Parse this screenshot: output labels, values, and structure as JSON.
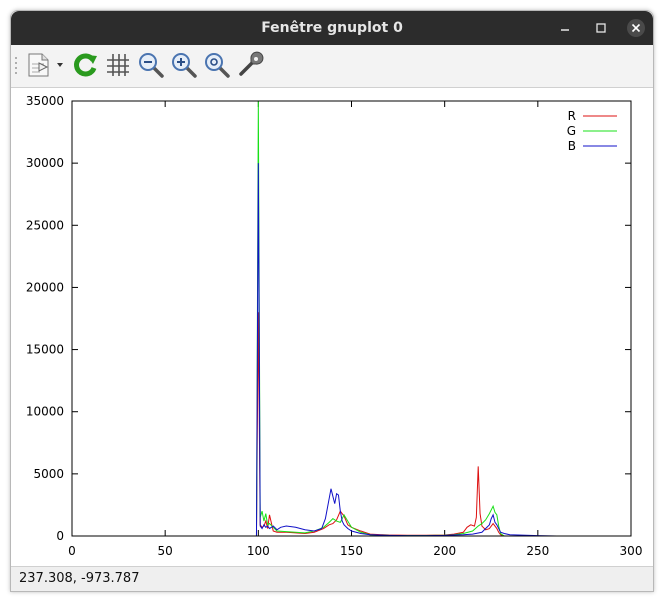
{
  "window": {
    "title": "Fenêtre gnuplot 0"
  },
  "toolbar": {
    "icons": [
      "export-icon",
      "replot-icon",
      "grid-icon",
      "zoom-out-icon",
      "zoom-in-icon",
      "zoom-reset-icon",
      "settings-icon"
    ]
  },
  "statusbar": {
    "coords": "237.308, -973.787"
  },
  "colors": {
    "R": "#dd1010",
    "G": "#18e018",
    "B": "#1010c8"
  },
  "chart_data": {
    "type": "line",
    "title": "",
    "xlabel": "",
    "ylabel": "",
    "xlim": [
      0,
      300
    ],
    "ylim": [
      0,
      35000
    ],
    "xticks": [
      0,
      50,
      100,
      150,
      200,
      250,
      300
    ],
    "yticks": [
      0,
      5000,
      10000,
      15000,
      20000,
      25000,
      30000,
      35000
    ],
    "grid": false,
    "legend_position": "top-right",
    "series": [
      {
        "name": "R",
        "x": [
          0,
          98,
          99,
          100,
          101,
          102,
          103,
          104,
          105,
          106,
          108,
          110,
          115,
          120,
          125,
          130,
          135,
          138,
          140,
          142,
          144,
          146,
          148,
          150,
          155,
          160,
          170,
          180,
          190,
          200,
          205,
          210,
          212,
          214,
          216,
          217,
          218,
          219,
          220,
          222,
          224,
          226,
          228,
          229,
          230,
          232
        ],
        "y": [
          0,
          0,
          0,
          18000,
          900,
          700,
          800,
          1200,
          600,
          1700,
          400,
          300,
          300,
          250,
          200,
          300,
          600,
          900,
          1000,
          1300,
          2000,
          1600,
          900,
          700,
          400,
          150,
          80,
          60,
          60,
          80,
          150,
          300,
          700,
          900,
          800,
          1500,
          5600,
          1800,
          800,
          500,
          600,
          1000,
          600,
          300,
          100,
          0
        ]
      },
      {
        "name": "G",
        "x": [
          0,
          98,
          99,
          100,
          101,
          102,
          103,
          104,
          105,
          106,
          108,
          110,
          115,
          120,
          125,
          130,
          135,
          138,
          140,
          142,
          144,
          146,
          148,
          150,
          155,
          160,
          170,
          180,
          190,
          200,
          205,
          210,
          215,
          218,
          220,
          222,
          224,
          226,
          227,
          228,
          229,
          230,
          232
        ],
        "y": [
          0,
          0,
          0,
          35000,
          1500,
          2000,
          1200,
          1800,
          900,
          1000,
          700,
          400,
          350,
          300,
          250,
          400,
          700,
          1100,
          1400,
          1200,
          1100,
          1700,
          1200,
          700,
          300,
          100,
          50,
          40,
          40,
          60,
          100,
          200,
          400,
          800,
          1000,
          1300,
          1800,
          2400,
          1900,
          1700,
          800,
          200,
          0
        ]
      },
      {
        "name": "B",
        "x": [
          0,
          98,
          99,
          100,
          101,
          102,
          103,
          104,
          105,
          106,
          108,
          110,
          112,
          115,
          120,
          125,
          130,
          134,
          136,
          138,
          139,
          140,
          141,
          142,
          143,
          144,
          145,
          146,
          148,
          150,
          155,
          160,
          170,
          180,
          190,
          200,
          205,
          210,
          215,
          220,
          222,
          224,
          225,
          226,
          227,
          228,
          229,
          230,
          232,
          235,
          250,
          260
        ],
        "y": [
          0,
          0,
          0,
          30000,
          800,
          600,
          900,
          700,
          800,
          600,
          800,
          500,
          700,
          800,
          700,
          500,
          400,
          600,
          1400,
          3000,
          3800,
          3200,
          2600,
          3400,
          3300,
          2000,
          1200,
          900,
          600,
          400,
          200,
          100,
          50,
          30,
          30,
          50,
          80,
          100,
          150,
          300,
          600,
          900,
          1400,
          1700,
          1100,
          900,
          600,
          300,
          200,
          100,
          30,
          0
        ]
      }
    ]
  }
}
